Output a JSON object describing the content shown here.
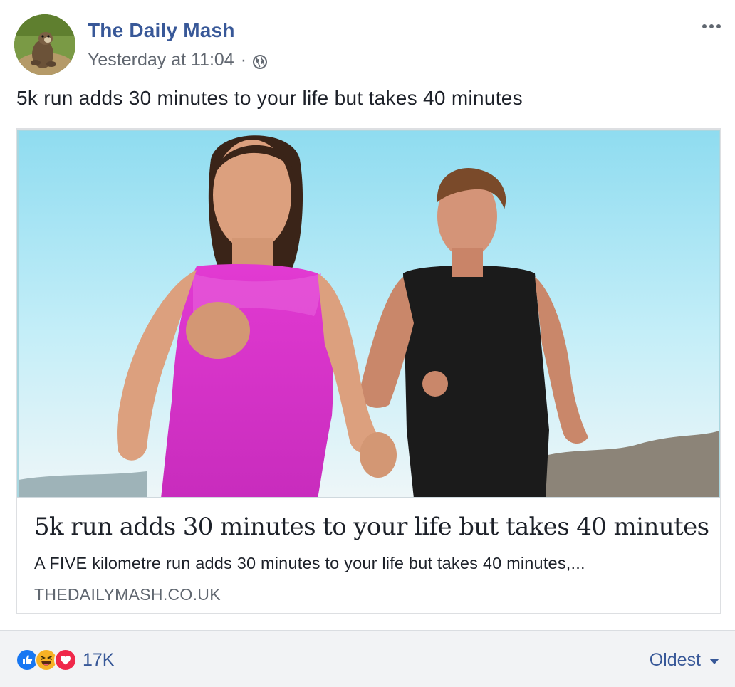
{
  "header": {
    "page_name": "The Daily Mash",
    "timestamp": "Yesterday at 11:04",
    "separator": "·",
    "privacy_icon": "globe-icon",
    "more_icon": "more-options-icon"
  },
  "post": {
    "text": "5k run adds 30 minutes to your life but takes 40 minutes"
  },
  "link": {
    "title": "5k run adds 30 minutes to your life but takes 40 minutes",
    "description": "A FIVE kilometre run adds 30 minutes to your life but takes 40 minutes,...",
    "domain": "THEDAILYMASH.CO.UK"
  },
  "footer": {
    "reaction_icons": [
      "like-icon",
      "haha-icon",
      "love-icon"
    ],
    "reaction_count": "17K",
    "sort_label": "Oldest"
  },
  "colors": {
    "link_blue": "#385898",
    "meta_gray": "#616770",
    "footer_bg": "#f2f3f5",
    "like_blue": "#1877f2",
    "love_red": "#f0284a",
    "haha_yellow": "#f7b125"
  }
}
